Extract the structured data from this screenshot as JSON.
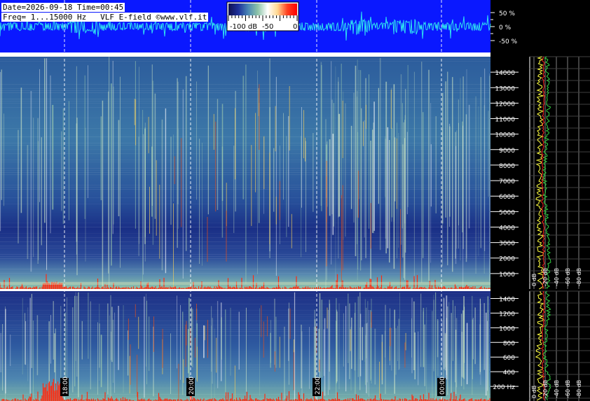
{
  "header": {
    "line1": "Date=2026-09-18 Time=00:45",
    "line2": "Freq= 1...15000 Hz   VLF E-field ©www.vlf.it"
  },
  "colorbar": {
    "labels": [
      "-100 dB",
      "-50",
      "0"
    ],
    "stops": [
      "#101050",
      "#1c2f9a",
      "#4a86b4",
      "#8ec4a8",
      "#ffffff",
      "#ffd890",
      "#ff4020",
      "#ff0000"
    ]
  },
  "colors": {
    "waveform_bg": "#0a18ff",
    "waveform_trace": "#2ee0f0",
    "spectrum_line_yellow": "#ffff40",
    "spectrum_line_green": "#30d040",
    "spectrum_line_red": "#ff2020",
    "burst": "#ff2a10"
  },
  "chart_data": [
    {
      "type": "line",
      "panel": "waveform",
      "y_ticks": [
        "50 %",
        "0 %",
        "-50 %"
      ]
    },
    {
      "type": "heatmap",
      "panel": "spectrogram-wideband",
      "y_ticks": [
        "14000",
        "13000",
        "12000",
        "11000",
        "10000",
        "9000",
        "8000",
        "7000",
        "6000",
        "5000",
        "4000",
        "3000",
        "2000",
        "1000"
      ],
      "ylim": [
        0,
        15000
      ],
      "x_ticks": [
        "18:00",
        "20:00",
        "22:00",
        "00:00"
      ]
    },
    {
      "type": "heatmap",
      "panel": "spectrogram-lowband",
      "y_ticks": [
        "1400",
        "1200",
        "1000",
        "800",
        "600",
        "400",
        "200 Hz"
      ],
      "ylim": [
        0,
        1500
      ],
      "x_ticks": [
        "18:00",
        "20:00",
        "22:00",
        "00:00"
      ]
    },
    {
      "type": "line",
      "panel": "spectrum-profile",
      "x_ticks": [
        "0 dB",
        "-20 dB",
        "-40 dB",
        "-60 dB",
        "-80 dB"
      ]
    }
  ]
}
